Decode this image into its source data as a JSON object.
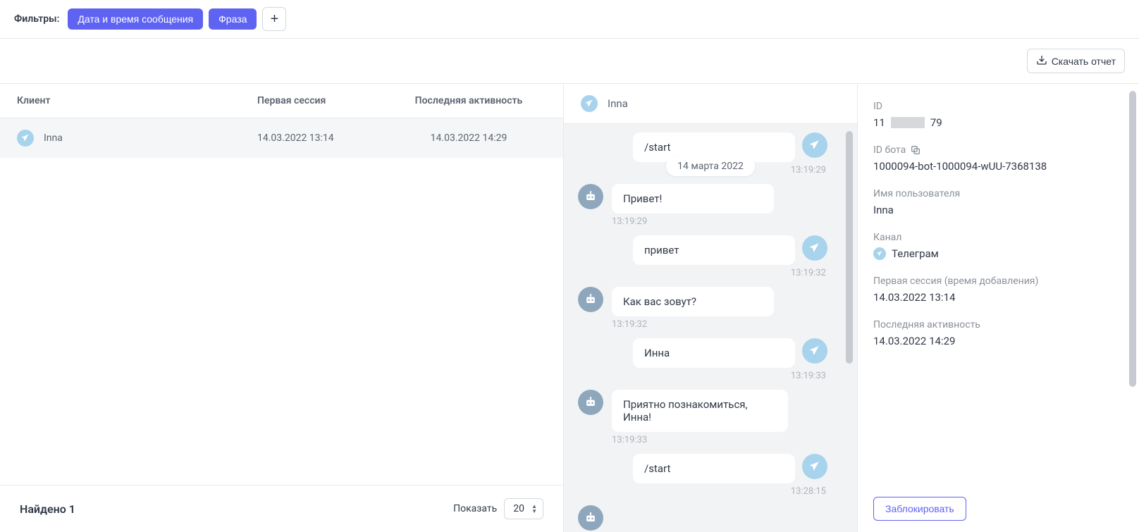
{
  "filters": {
    "label": "Фильтры:",
    "chips": [
      "Дата и время сообщения",
      "Фраза"
    ]
  },
  "download_label": "Скачать отчет",
  "table": {
    "headers": {
      "client": "Клиент",
      "first": "Первая сессия",
      "last": "Последняя активность"
    },
    "rows": [
      {
        "name": "Inna",
        "first": "14.03.2022 13:14",
        "last": "14.03.2022 14:29"
      }
    ],
    "found_label": "Найдено 1",
    "show_label": "Показать",
    "page_size": "20"
  },
  "chat": {
    "title": "Inna",
    "date_pill": "14 марта 2022",
    "messages": [
      {
        "who": "user",
        "text": "/start",
        "time": "13:19:29"
      },
      {
        "who": "bot",
        "text": "Привет!",
        "time": "13:19:29"
      },
      {
        "who": "user",
        "text": "привет",
        "time": "13:19:32"
      },
      {
        "who": "bot",
        "text": "Как вас зовут?",
        "time": "13:19:32"
      },
      {
        "who": "user",
        "text": "Инна",
        "time": "13:19:33"
      },
      {
        "who": "bot",
        "text": "Приятно познакомиться, Инна!",
        "time": "13:19:33"
      },
      {
        "who": "user",
        "text": "/start",
        "time": "13:28:15"
      }
    ]
  },
  "details": {
    "id_label": "ID",
    "id_prefix": "11",
    "id_suffix": "79",
    "bot_id_label": "ID бота",
    "bot_id": "1000094-bot-1000094-wUU-7368138",
    "username_label": "Имя пользователя",
    "username": "Inna",
    "channel_label": "Канал",
    "channel": "Телеграм",
    "first_label": "Первая сессия (время добавления)",
    "first": "14.03.2022 13:14",
    "last_label": "Последняя активность",
    "last": "14.03.2022 14:29",
    "block_label": "Заблокировать"
  }
}
